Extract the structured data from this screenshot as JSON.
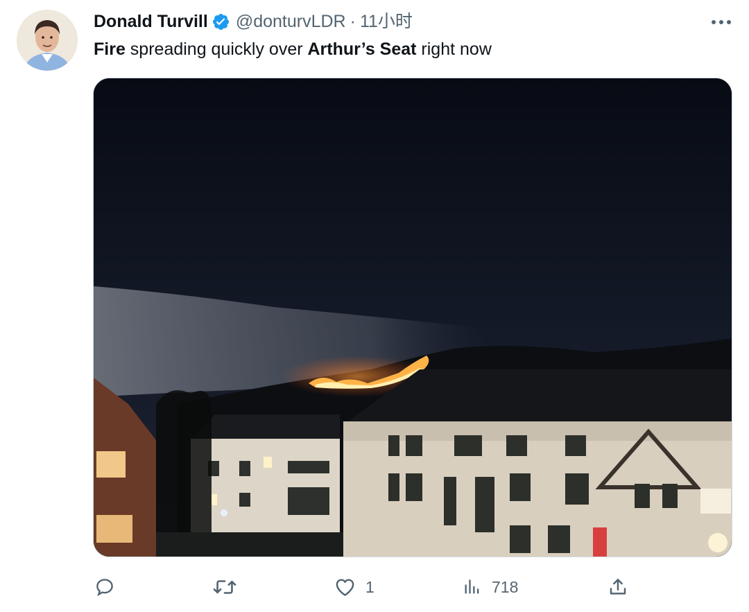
{
  "tweet": {
    "author": {
      "display_name": "Donald Turvill",
      "handle": "@donturvLDR",
      "separator": "·",
      "time": "11小时",
      "verified": true,
      "avatar_icon": "person-avatar"
    },
    "text": {
      "part1": "Fire",
      "part2": " spreading quickly over ",
      "part3": "Arthur’s Seat",
      "part4": " right now"
    },
    "media": {
      "type": "photo",
      "subject": "night fire on hillside above buildings"
    },
    "actions": {
      "reply": {
        "icon": "reply-icon",
        "count": ""
      },
      "retweet": {
        "icon": "retweet-icon",
        "count": ""
      },
      "like": {
        "icon": "heart-icon",
        "count": "1"
      },
      "views": {
        "icon": "views-icon",
        "count": "718"
      },
      "share": {
        "icon": "share-icon",
        "count": ""
      }
    }
  },
  "colors": {
    "text": "#0f1419",
    "secondary": "#536471",
    "verified": "#1d9bf0",
    "border": "#cfd9de"
  }
}
